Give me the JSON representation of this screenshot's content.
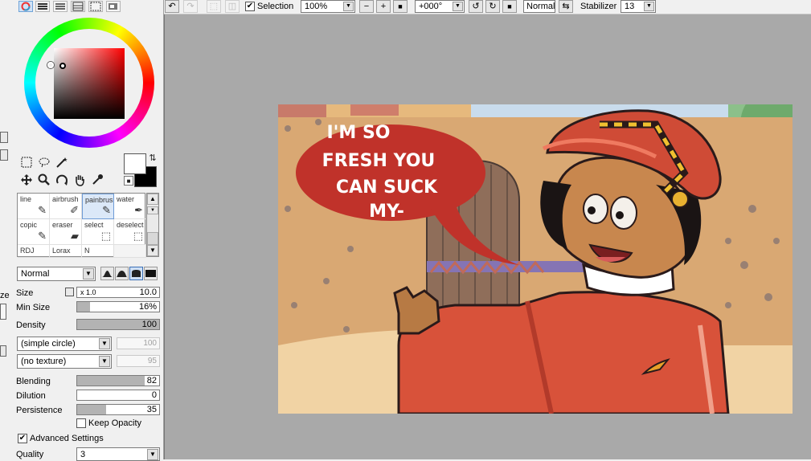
{
  "edge": {
    "partial_text": "ze"
  },
  "brush_tools": [
    {
      "label": "line",
      "icon": "pen-icon"
    },
    {
      "label": "airbrush",
      "icon": "airbrush-icon"
    },
    {
      "label": "painbrus",
      "icon": "paintbrush-icon"
    },
    {
      "label": "water",
      "icon": "water-brush-icon"
    },
    {
      "label": "copic",
      "icon": "marker-icon"
    },
    {
      "label": "eraser",
      "icon": "eraser-icon"
    },
    {
      "label": "select",
      "icon": "select-brush-icon"
    },
    {
      "label": "deselect",
      "icon": "deselect-brush-icon"
    },
    {
      "label": "RDJ",
      "icon": ""
    },
    {
      "label": "Lorax",
      "icon": ""
    },
    {
      "label": "N",
      "icon": ""
    },
    {
      "label": "",
      "icon": ""
    }
  ],
  "brush_settings": {
    "blend_mode": "Normal",
    "size_label": "Size",
    "size_multiplier": "x 1.0",
    "size_value": "10.0",
    "min_size_label": "Min Size",
    "min_size_value": "16%",
    "min_size_fraction": 0.16,
    "density_label": "Density",
    "density_value": "100",
    "density_fraction": 1.0,
    "shape_select": "(simple circle)",
    "shape_value": "100",
    "texture_select": "(no texture)",
    "texture_value": "95",
    "blending_label": "Blending",
    "blending_value": "82",
    "blending_fraction": 0.82,
    "dilution_label": "Dilution",
    "dilution_value": "0",
    "dilution_fraction": 0.0,
    "persistence_label": "Persistence",
    "persistence_value": "35",
    "persistence_fraction": 0.35,
    "keep_opacity_label": "Keep Opacity",
    "keep_opacity_checked": false,
    "advanced_label": "Advanced Settings",
    "advanced_checked": true,
    "quality_label": "Quality",
    "quality_value": "3"
  },
  "toolbar": {
    "selection_label": "Selection",
    "selection_checked": true,
    "zoom_value": "100%",
    "rotation_value": "+000°",
    "blend_mode": "Normal",
    "stabilizer_label": "Stabilizer",
    "stabilizer_value": "13"
  },
  "canvas": {
    "speech_lines": [
      "I'M SO",
      "FRESH YOU",
      "CAN SUCK",
      "MY-"
    ]
  },
  "colors": {
    "primary": "#ffffff",
    "secondary": "#000000",
    "speech_bubble": "#c0322a",
    "workspace": "#a9a9a9"
  }
}
